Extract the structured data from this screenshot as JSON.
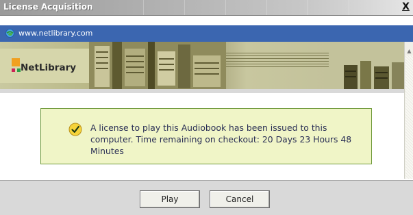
{
  "window": {
    "title": "License Acquisition",
    "close_label": "X"
  },
  "address": {
    "url": "www.netlibrary.com",
    "icon": "ie-globe-icon"
  },
  "banner": {
    "logo_text": "NetLibrary",
    "logo_colors": [
      "#f0a020",
      "#cc2255",
      "#2aa048"
    ]
  },
  "message": {
    "icon": "check-icon",
    "text": "A license to play this Audiobook has been issued to this computer. Time remaining on checkout: 20 Days 23 Hours 48 Minutes"
  },
  "buttons": {
    "play_label": "Play",
    "cancel_label": "Cancel"
  },
  "colors": {
    "address_bar": "#3b66b0",
    "message_bg": "#f0f5c7",
    "message_border": "#6f9a3a"
  }
}
